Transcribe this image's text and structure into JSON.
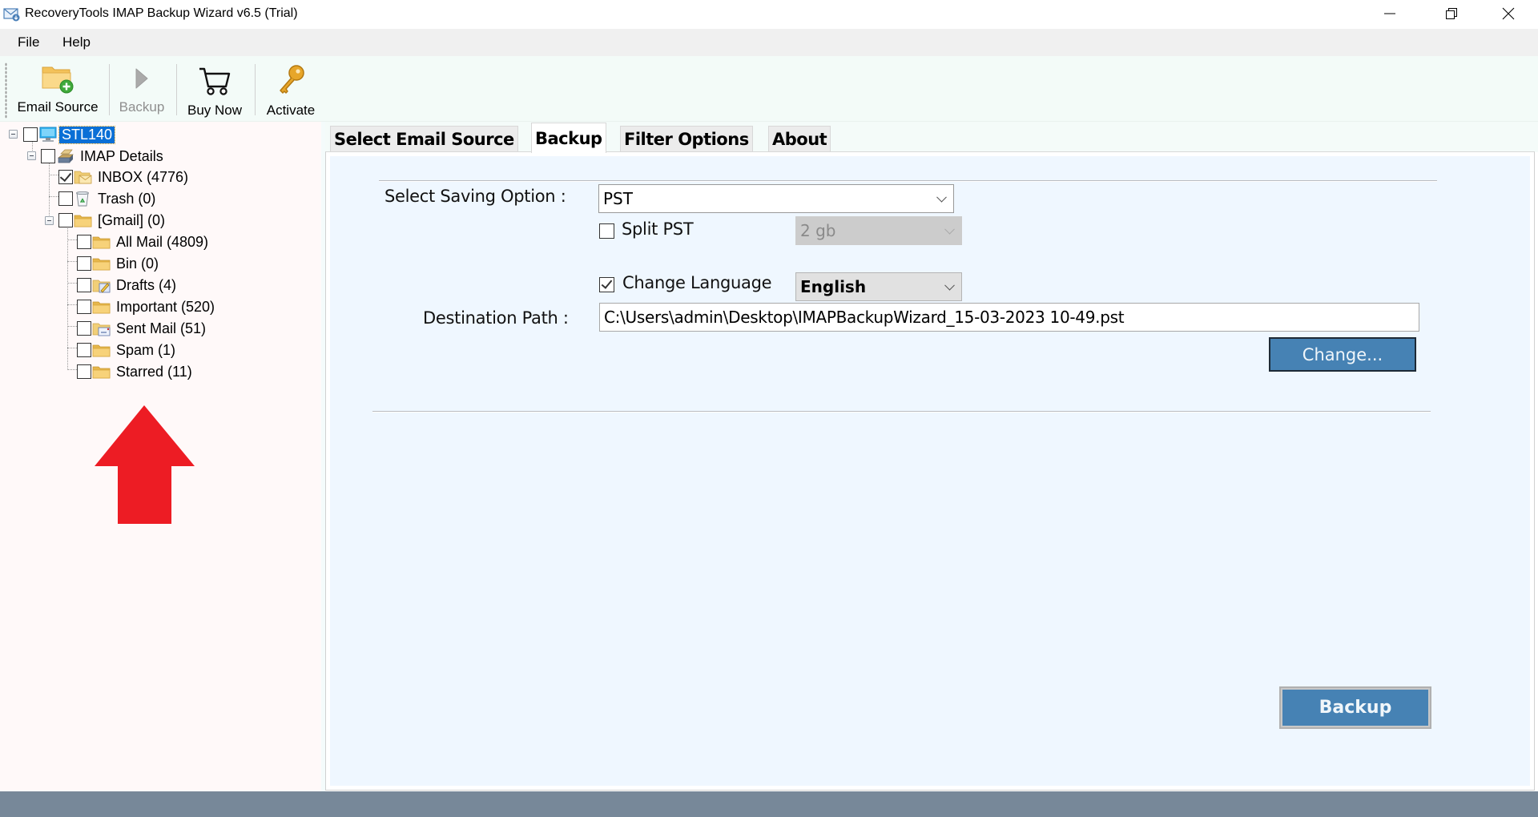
{
  "window": {
    "title": "RecoveryTools IMAP Backup Wizard v6.5 (Trial)",
    "controls": [
      "minimize",
      "restore",
      "close"
    ]
  },
  "menu": {
    "items": [
      {
        "label": "File"
      },
      {
        "label": "Help"
      }
    ]
  },
  "toolbar": {
    "buttons": [
      {
        "label": "Email Source",
        "icon": "folder-add-icon",
        "enabled": true
      },
      {
        "label": "Backup",
        "icon": "play-icon",
        "enabled": false
      },
      {
        "label": "Buy Now",
        "icon": "cart-icon",
        "enabled": true
      },
      {
        "label": "Activate",
        "icon": "key-icon",
        "enabled": true
      }
    ]
  },
  "tree": {
    "root": {
      "label": "STL140",
      "checked": false,
      "selected": true,
      "icon": "computer-icon"
    },
    "account": {
      "label": "IMAP Details",
      "checked": false,
      "icon": "imap-stack-icon"
    },
    "folders": [
      {
        "label": "INBOX (4776)",
        "checked": true,
        "icon": "inbox-folder-icon"
      },
      {
        "label": "Trash (0)",
        "checked": false,
        "icon": "recycle-bin-icon"
      },
      {
        "label": "[Gmail] (0)",
        "checked": false,
        "icon": "folder-icon"
      }
    ],
    "gmail_subfolders": [
      {
        "label": "All Mail (4809)",
        "checked": false,
        "icon": "folder-icon"
      },
      {
        "label": "Bin (0)",
        "checked": false,
        "icon": "folder-icon"
      },
      {
        "label": "Drafts (4)",
        "checked": false,
        "icon": "drafts-folder-icon"
      },
      {
        "label": "Important (520)",
        "checked": false,
        "icon": "folder-icon"
      },
      {
        "label": "Sent Mail (51)",
        "checked": false,
        "icon": "sent-folder-icon"
      },
      {
        "label": "Spam (1)",
        "checked": false,
        "icon": "folder-icon"
      },
      {
        "label": "Starred (11)",
        "checked": false,
        "icon": "folder-icon"
      }
    ]
  },
  "annotation": {
    "arrow_color": "#ed1c24",
    "direction": "up"
  },
  "tabs": [
    {
      "label": "Select Email Source",
      "active": false
    },
    {
      "label": "Backup",
      "active": true
    },
    {
      "label": "Filter Options",
      "active": false
    },
    {
      "label": "About",
      "active": false
    }
  ],
  "backup": {
    "saving_option_label": "Select Saving Option :",
    "saving_option_value": "PST",
    "split_pst": {
      "label": "Split PST",
      "checked": false,
      "size_value": "2 gb",
      "size_enabled": false
    },
    "change_language": {
      "label": "Change Language",
      "checked": true,
      "value": "English"
    },
    "destination_label": "Destination Path :",
    "destination_value": "C:\\Users\\admin\\Desktop\\IMAPBackupWizard_15-03-2023 10-49.pst",
    "change_button": "Change...",
    "backup_button": "Backup"
  },
  "colors": {
    "accent_button": "#4682b4",
    "selection": "#0a6fd6",
    "status_bar": "#778899",
    "panel_bg": "#eff7ff",
    "tree_bg": "#fff9f9"
  }
}
